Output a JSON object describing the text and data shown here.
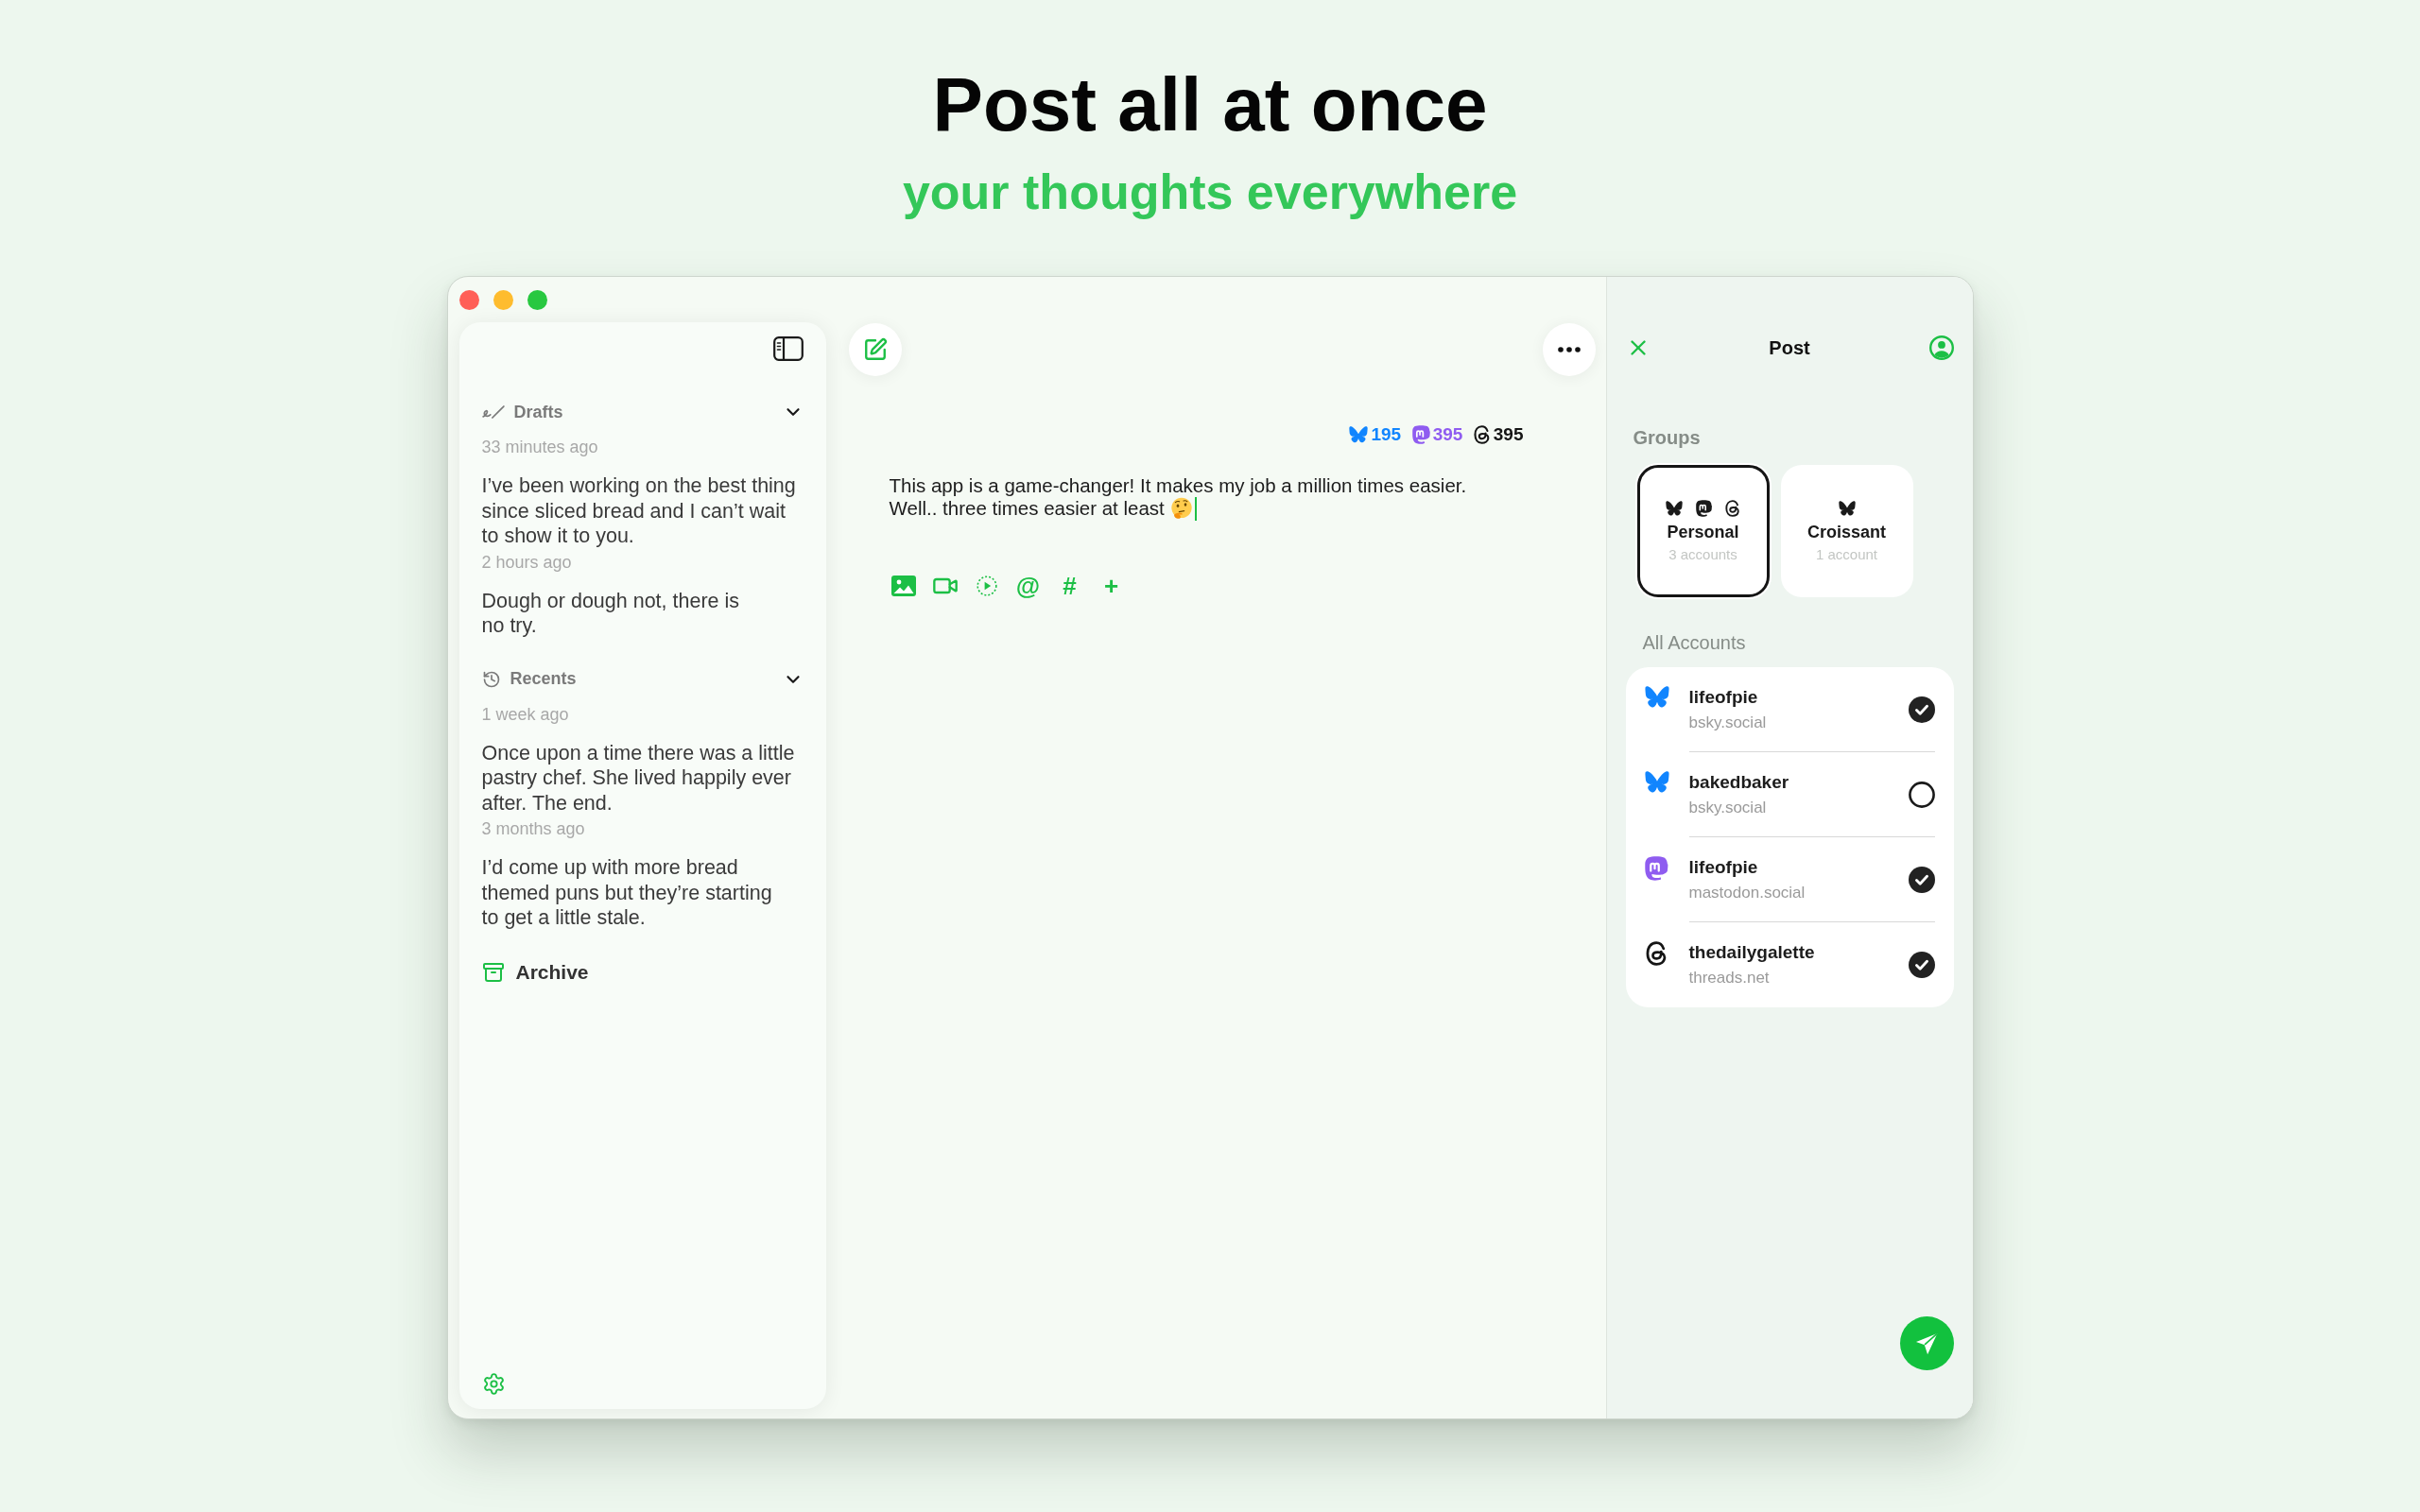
{
  "hero": {
    "title": "Post all at once",
    "subtitle": "your thoughts everywhere"
  },
  "sidebar": {
    "sections": [
      {
        "kind": "drafts",
        "title": "Drafts",
        "expanded": true,
        "items": [
          {
            "time": "33 minutes ago",
            "text": "I’ve been working on the best thing\nsince sliced bread and I can’t wait\nto show it to you."
          },
          {
            "time": "2 hours ago",
            "text": "Dough or dough not, there is\nno try."
          }
        ]
      },
      {
        "kind": "recents",
        "title": "Recents",
        "expanded": true,
        "items": [
          {
            "time": "1 week ago",
            "text": "Once upon a time there was a little\npastry chef. She lived happily ever\nafter. The end."
          },
          {
            "time": "3 months ago",
            "text": "I’d come up with more bread\nthemed puns but they’re starting\nto get a little stale."
          }
        ]
      }
    ],
    "archive": "Archive"
  },
  "editor": {
    "counts": [
      {
        "kind": "bluesky",
        "count": "195"
      },
      {
        "kind": "mastodon",
        "count": "395"
      },
      {
        "kind": "threads",
        "count": "395"
      }
    ],
    "lines": [
      "This app is a game-changer! It makes my job a million times easier.",
      "Well.. three times easier at least"
    ],
    "toolbar_symbols": [
      "@",
      "#",
      "+"
    ]
  },
  "post_panel": {
    "title": "Post",
    "groups_label": "Groups",
    "groups": [
      {
        "name": "Personal",
        "count": "3 accounts",
        "selected": true,
        "platforms": [
          {
            "kind": "bluesky"
          },
          {
            "kind": "mastodon"
          },
          {
            "kind": "threads"
          }
        ]
      },
      {
        "name": "Croissant",
        "count": "1 account",
        "selected": false,
        "platforms": [
          {
            "kind": "bluesky"
          }
        ]
      }
    ],
    "accounts_label": "All Accounts",
    "accounts": [
      {
        "kind": "bluesky",
        "name": "lifeofpie",
        "server": "bsky.social",
        "checked": true
      },
      {
        "kind": "bluesky",
        "name": "bakedbaker",
        "server": "bsky.social",
        "checked": false
      },
      {
        "kind": "mastodon",
        "name": "lifeofpie",
        "server": "mastodon.social",
        "checked": true
      },
      {
        "kind": "threads",
        "name": "thedailygalette",
        "server": "threads.net",
        "checked": true
      }
    ]
  }
}
